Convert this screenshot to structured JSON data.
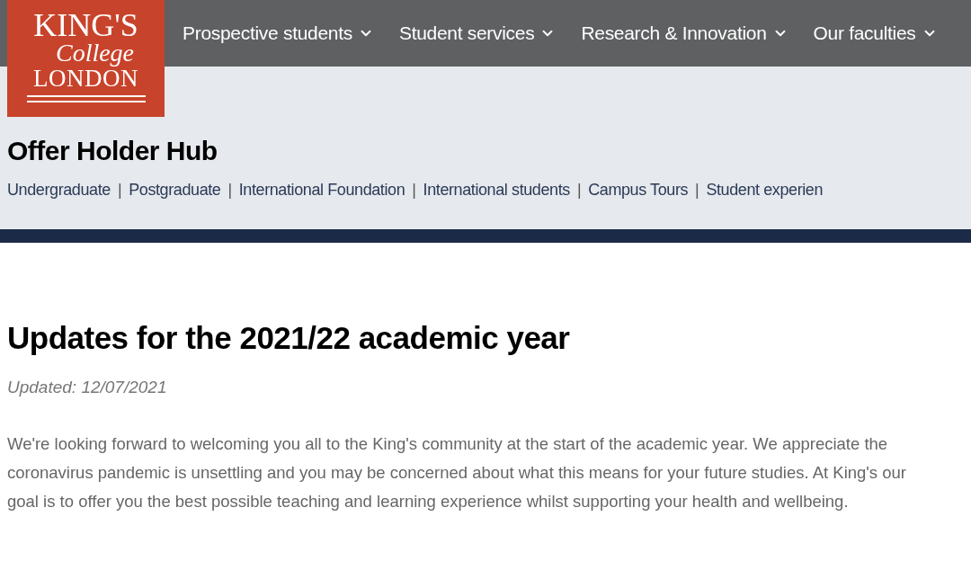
{
  "logo": {
    "lines": [
      "KING'S",
      "College",
      "LONDON"
    ]
  },
  "top_nav": [
    {
      "label": "Prospective students"
    },
    {
      "label": "Student services"
    },
    {
      "label": "Research & Innovation"
    },
    {
      "label": "Our faculties"
    }
  ],
  "hub_title": "Offer Holder Hub",
  "sub_nav": [
    "Undergraduate",
    "Postgraduate",
    "International Foundation",
    "International students",
    "Campus Tours",
    "Student experien"
  ],
  "separator": "|",
  "article": {
    "title": "Updates for the 2021/22 academic year",
    "updated": "Updated: 12/07/2021",
    "paragraph": "We're looking forward to welcoming you all to the King's community at the start of the academic year. We appreciate the coronavirus pandemic is unsettling and you may be concerned about what this means for your future studies. At King's our goal is to offer you the best possible teaching and learning experience whilst supporting your health and wellbeing."
  }
}
